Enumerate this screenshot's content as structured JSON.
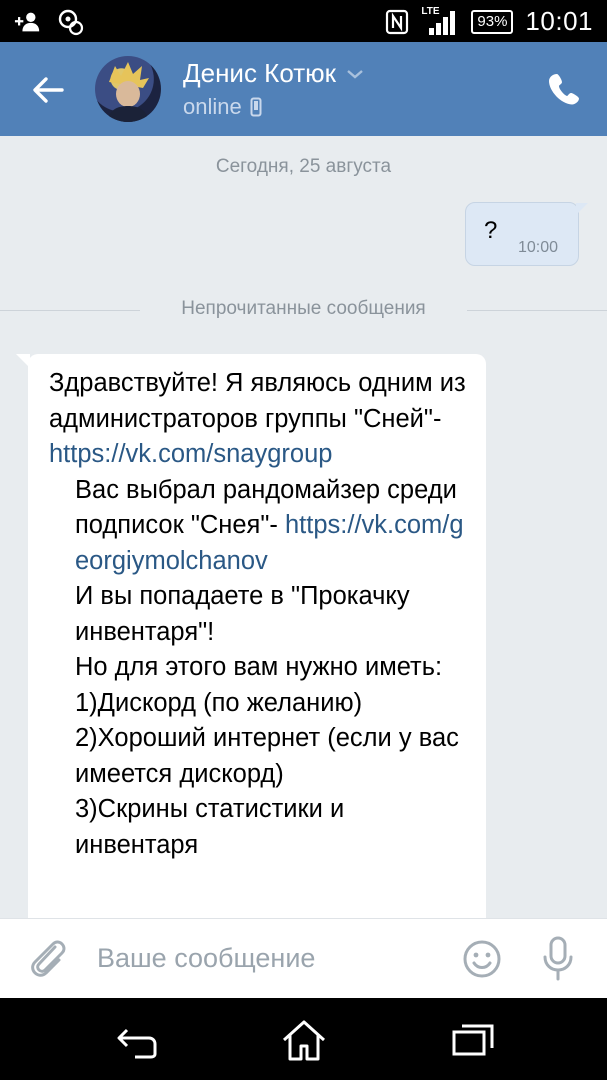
{
  "status_bar": {
    "network": "LTE",
    "battery": "93%",
    "time": "10:01"
  },
  "header": {
    "contact_name": "Денис Котюк",
    "status": "online"
  },
  "chat": {
    "date_separator": "Сегодня, 25 августа",
    "outgoing": {
      "text": "?",
      "time": "10:00"
    },
    "unread_separator": "Непрочитанные сообщения",
    "incoming": {
      "line1": "Здравствуйте! Я являюсь одним из администраторов группы \"Сней\"- ",
      "link1": "https://vk.com/snaygroup",
      "line2": "Вас выбрал рандомайзер среди подписок \"Снея\"- ",
      "link2": "https://vk.com/georgiymolchanov",
      "line3": "И вы попадаете в \"Прокачку инвентаря\"!",
      "line4": "Но для этого вам нужно иметь:",
      "item1": "1)Дискорд (по желанию)",
      "item2": "2)Хороший интернет (если у вас имеется дискорд)",
      "item3": "3)Скрины статистики и инвентаря"
    }
  },
  "composer": {
    "placeholder": "Ваше сообщение"
  },
  "icons": {
    "back": "back-arrow-icon",
    "call": "phone-icon",
    "attach": "paperclip-icon",
    "emoji": "smile-icon",
    "voice": "microphone-icon"
  },
  "colors": {
    "header": "#5181b8",
    "link": "#2a5885",
    "outgoing_bubble": "#dde8f5"
  }
}
